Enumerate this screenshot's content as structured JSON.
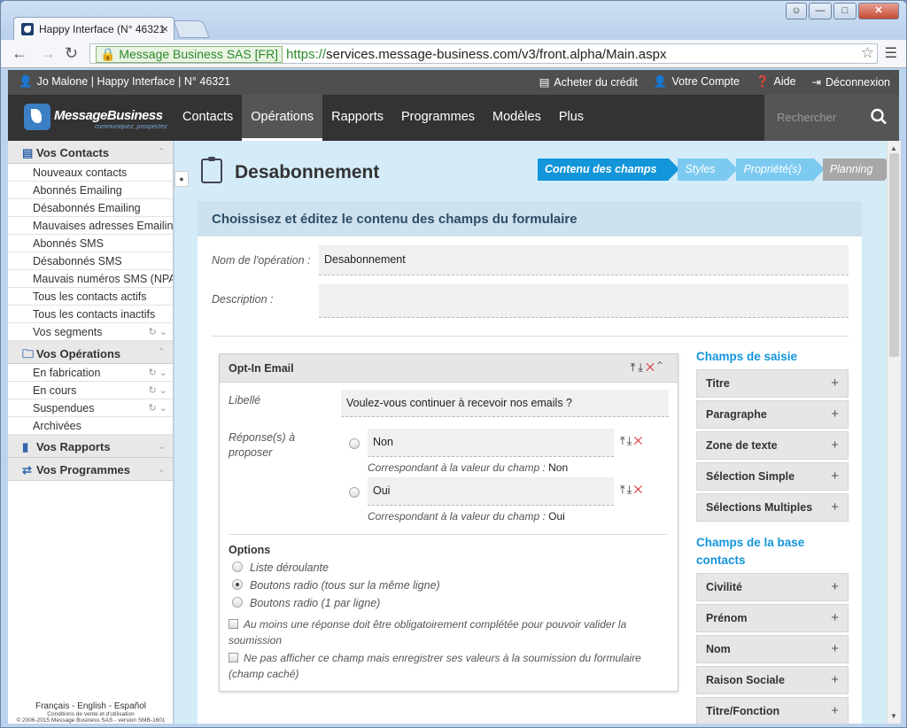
{
  "browser": {
    "tab_title": "Happy Interface (N° 46321",
    "tab_close": "×",
    "ssl_label": "Message Business SAS [FR]",
    "url_scheme": "https://",
    "url_rest": "services.message-business.com/v3/front.alpha/Main.aspx"
  },
  "topbar": {
    "user_info": "Jo Malone  |  Happy Interface  |  N° 46321",
    "links": [
      "Acheter du crédit",
      "Votre Compte",
      "Aide",
      "Déconnexion"
    ]
  },
  "nav": {
    "logo_name": "MessageBusiness",
    "logo_tag": "communiquez, prospectez",
    "items": [
      "Contacts",
      "Opérations",
      "Rapports",
      "Programmes",
      "Modèles",
      "Plus"
    ],
    "active": "Opérations",
    "search_placeholder": "Rechercher"
  },
  "sidebar": {
    "contacts_title": "Vos Contacts",
    "contacts_items": [
      "Nouveaux contacts",
      "Abonnés Emailing",
      "Désabonnés Emailing",
      "Mauvaises adresses Emailing",
      "Abonnés SMS",
      "Désabonnés SMS",
      "Mauvais numéros SMS (NPAI)",
      "Tous les contacts actifs",
      "Tous les contacts inactifs",
      "Vos segments"
    ],
    "operations_title": "Vos Opérations",
    "operations_items": [
      "En fabrication",
      "En cours",
      "Suspendues",
      "Archivées"
    ],
    "rapports_title": "Vos Rapports",
    "programmes_title": "Vos Programmes",
    "footer_langs": "Français - English - Español",
    "footer_terms": "Conditions de vente et d'utilisation",
    "footer_copy": "© 2006-2015 Message Business SAS - version SMB-1601"
  },
  "page": {
    "title": "Desabonnement",
    "steps": [
      "Contenu des champs",
      "Styles",
      "Propriété(s)",
      "Planning"
    ],
    "panel_title": "Choissisez et éditez le contenu des champs du formulaire",
    "op_name_label": "Nom de l'opération :",
    "op_name_value": "Desabonnement",
    "description_label": "Description :",
    "description_value": ""
  },
  "block": {
    "title": "Opt-In Email",
    "libelle_label": "Libellé",
    "libelle_value": "Voulez-vous continuer à recevoir nos emails ?",
    "reponses_label": "Réponse(s) à proposer",
    "answers": [
      {
        "label": "Non",
        "corr": "Correspondant à la valeur du champ :",
        "value": "Non"
      },
      {
        "label": "Oui",
        "corr": "Correspondant à la valeur du champ :",
        "value": "Oui"
      }
    ],
    "options_title": "Options",
    "options": [
      "Liste déroulante",
      "Boutons radio (tous sur la même ligne)",
      "Boutons radio (1 par ligne)"
    ],
    "selected_option": 1,
    "check1": "Au moins une réponse doit être obligatoirement complétée pour pouvoir valider la soumission",
    "check2": "Ne pas afficher ce champ mais enregistrer ses valeurs à la soumission du formulaire (champ caché)"
  },
  "right": {
    "saisie_title": "Champs de saisie",
    "saisie_items": [
      "Titre",
      "Paragraphe",
      "Zone de texte",
      "Sélection Simple",
      "Sélections Multiples"
    ],
    "base_title": "Champs de la base contacts",
    "base_items": [
      "Civilité",
      "Prénom",
      "Nom",
      "Raison Sociale",
      "Titre/Fonction"
    ]
  },
  "colors": {
    "accent": "#1395da",
    "topbar": "#4f4f4f",
    "nav": "#333333",
    "content_bg": "#d4ecf8",
    "delete": "#dd3333"
  }
}
